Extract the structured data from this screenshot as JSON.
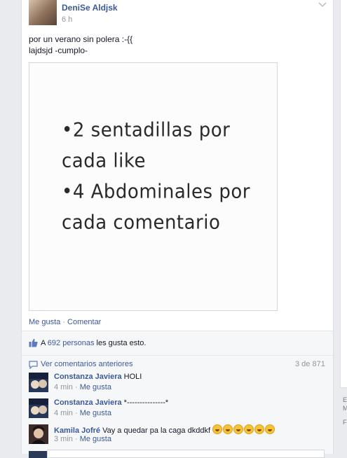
{
  "post": {
    "author": "DeniSe Aldjsk",
    "time": "6 h",
    "text_lines": [
      "por un verano sin polera :-{{",
      "lajdsjd -cumplo-"
    ],
    "image_lines": [
      "•2 sentadillas por",
      "cada like",
      "•4 Abdominales por",
      "cada comentario"
    ],
    "actions": {
      "like": "Me gusta",
      "separator": "·",
      "comment": "Comentar"
    }
  },
  "likes": {
    "prefix": "A",
    "link": "692 personas",
    "suffix": "les gusta esto."
  },
  "comments_section": {
    "view_previous": "Ver comentarios anteriores",
    "count": "3 de 871",
    "comments": [
      {
        "name": "Constanza Javiera",
        "text": "HOLI",
        "time": "4 min",
        "like": "Me gusta"
      },
      {
        "name": "Constanza Javiera",
        "text": "*---------------*",
        "time": "4 min",
        "like": "Me gusta"
      },
      {
        "name": "Kamila Jofré",
        "text": "Vay a quedar pa la caga dkddkf",
        "time": "3 min",
        "like": "Me gusta"
      }
    ]
  },
  "right_sidebar": {
    "letters": [
      "E",
      "M",
      "F"
    ]
  },
  "colors": {
    "link": "#3b5998",
    "muted": "#90949c",
    "background": "#e9ebee"
  }
}
